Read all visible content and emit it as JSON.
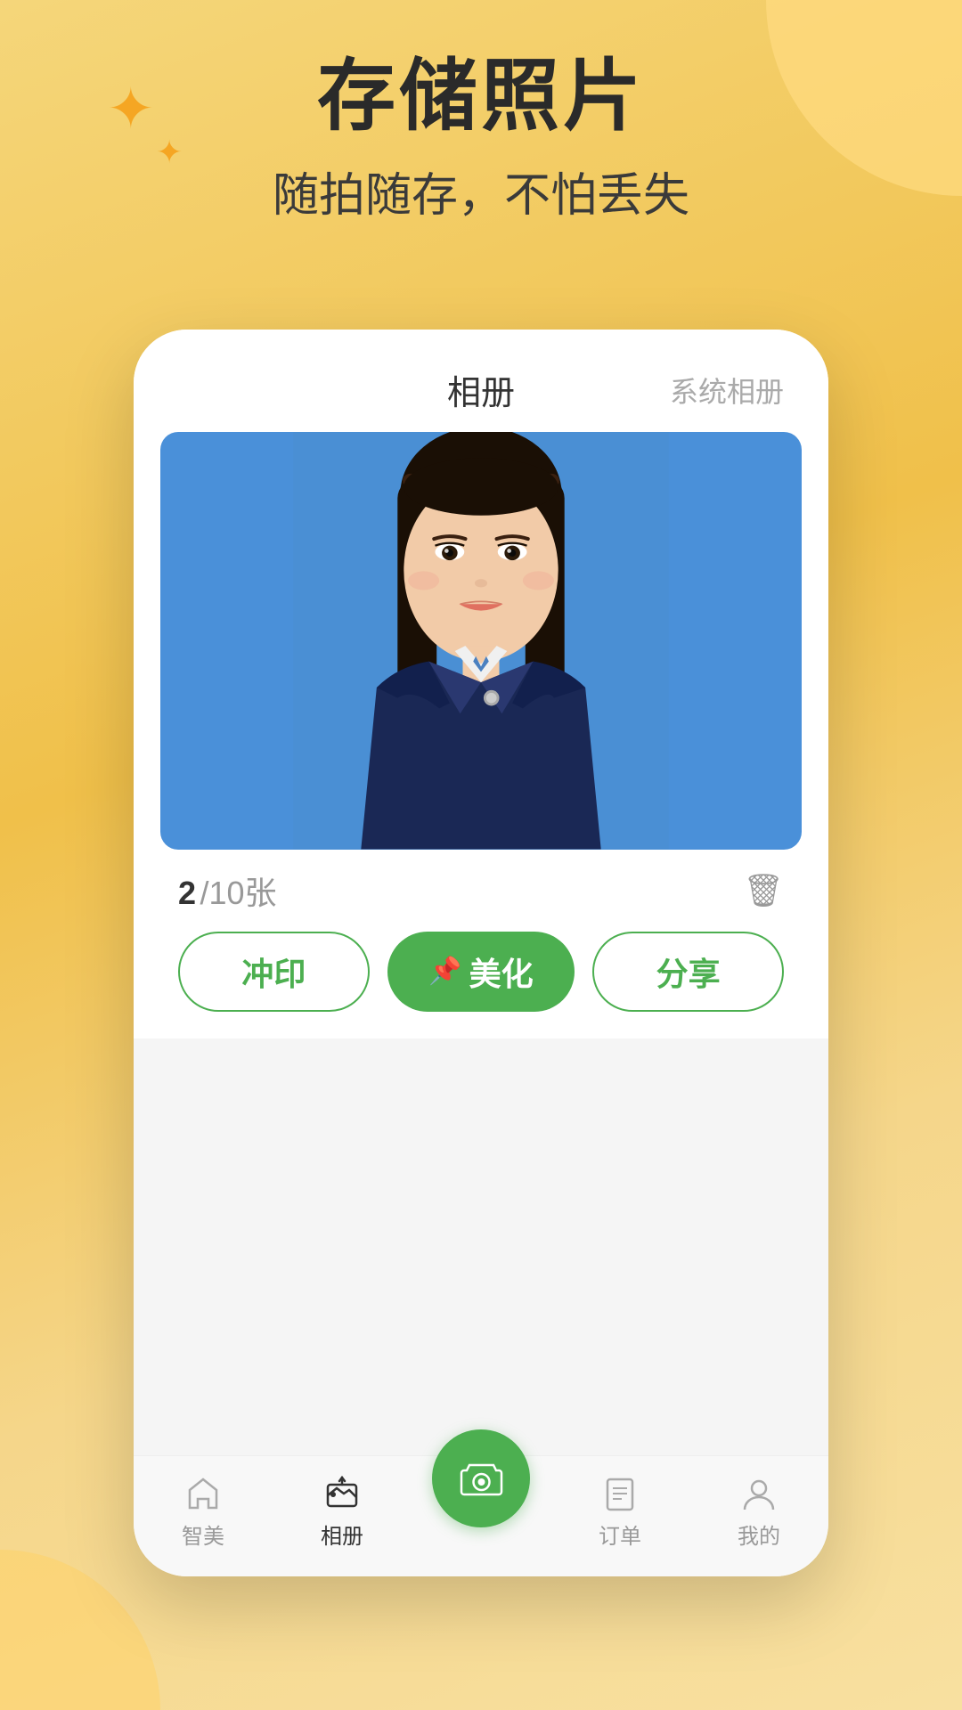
{
  "background": {
    "gradient_start": "#f5d67a",
    "gradient_end": "#f8e0a0"
  },
  "header": {
    "main_title": "存储照片",
    "sub_title": "随拍随存，不怕丢失"
  },
  "phone": {
    "tab_album": "相册",
    "tab_system": "系统相册",
    "photo_counter": "2",
    "photo_total": "/10张",
    "buttons": {
      "print": "冲印",
      "beautify": "美化",
      "share": "分享"
    }
  },
  "bottom_nav": {
    "items": [
      {
        "label": "智美",
        "icon": "home",
        "active": false
      },
      {
        "label": "相册",
        "icon": "album",
        "active": true
      },
      {
        "label": "",
        "icon": "camera",
        "active": false,
        "is_fab": true
      },
      {
        "label": "订单",
        "icon": "order",
        "active": false
      },
      {
        "label": "我的",
        "icon": "profile",
        "active": false
      }
    ]
  },
  "icons": {
    "star_large": "✦",
    "star_small": "✦",
    "delete": "🗑",
    "pin": "📌",
    "camera": "📷"
  }
}
